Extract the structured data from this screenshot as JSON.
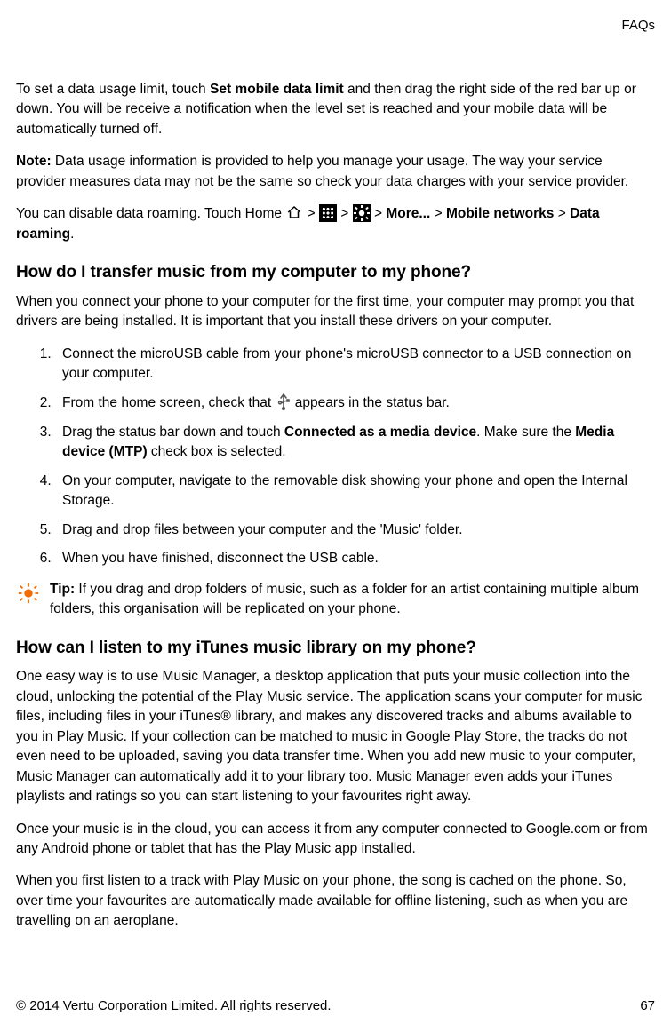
{
  "header": {
    "page_label": "FAQs"
  },
  "intro": {
    "p1_a": "To set a data usage limit, touch ",
    "p1_b": "Set mobile data limit",
    "p1_c": " and then drag the right side of the red bar up or down. You will be receive a notification when the level set is reached and your mobile data will be automatically turned off.",
    "p2_a": "Note:",
    "p2_b": " Data usage information is provided to help you manage your usage. The way your service provider measures data may not be the same so check your data charges with your service provider.",
    "p3_a": "You can disable data roaming. Touch Home ",
    "gt": " > ",
    "p3_more": "More...",
    "p3_mn": "Mobile networks",
    "p3_dr": "Data roaming",
    "p3_end": "."
  },
  "transfer": {
    "heading": "How do I transfer music from my computer to my phone?",
    "lead": "When you connect your phone to your computer for the first time, your computer may prompt you that drivers are being installed. It is important that you install these drivers on your computer.",
    "steps": {
      "s1": "Connect the microUSB cable from your phone's microUSB connector to a USB connection on your computer.",
      "s2_a": "From the home screen, check that ",
      "s2_b": " appears in the status bar.",
      "s3_a": "Drag the status bar down and touch ",
      "s3_b": "Connected as a media device",
      "s3_c": ". Make sure the ",
      "s3_d": "Media device (MTP)",
      "s3_e": " check box is selected.",
      "s4": "On your computer, navigate to the removable disk showing your phone and open the Internal Storage.",
      "s5": "Drag and drop files between your computer and the 'Music' folder.",
      "s6": "When you have finished, disconnect the USB cable."
    },
    "tip_a": "Tip:",
    "tip_b": " If you drag and drop folders of music, such as a folder for an artist containing multiple album folders, this organisation will be replicated on your phone."
  },
  "itunes": {
    "heading": "How can I listen to my iTunes music library on my phone?",
    "p1": "One easy way is to use Music Manager, a desktop application that puts your music collection into the cloud, unlocking the potential of the Play Music service. The application scans your computer for music files, including files in your iTunes® library, and makes any discovered tracks and albums available to you in Play Music. If your collection can be matched to music in Google Play Store, the tracks do not even need to be uploaded, saving you data transfer time. When you add new music to your computer, Music Manager can automatically add it to your library too. Music Manager even adds your iTunes playlists and ratings so you can start listening to your favourites right away.",
    "p2": "Once your music is in the cloud, you can access it from any computer connected to Google.com or from any Android phone or tablet that has the Play Music app installed.",
    "p3": "When you first listen to a track with Play Music on your phone, the song is cached on the phone. So, over time your favourites are automatically made available for offline listening, such as when you are travelling on an aeroplane."
  },
  "footer": {
    "copyright": "© 2014 Vertu Corporation Limited. All rights reserved.",
    "pagenum": "67"
  }
}
